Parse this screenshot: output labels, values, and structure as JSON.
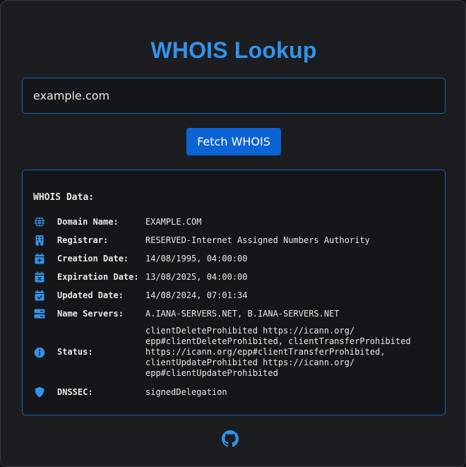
{
  "app": {
    "title": "WHOIS Lookup",
    "accent_color": "#3393ea",
    "button_color": "#0c63d4"
  },
  "search": {
    "value": "example.com",
    "button_label": "Fetch WHOIS"
  },
  "whois": {
    "heading": "WHOIS Data:",
    "rows": [
      {
        "icon": "globe-icon",
        "label": "Domain Name:",
        "value": "EXAMPLE.COM"
      },
      {
        "icon": "building-icon",
        "label": "Registrar:",
        "value": "RESERVED-Internet Assigned Numbers Authority"
      },
      {
        "icon": "calendar-plus-icon",
        "label": "Creation Date:",
        "value": "14/08/1995, 04:00:00"
      },
      {
        "icon": "calendar-x-icon",
        "label": "Expiration Date:",
        "value": "13/08/2025, 04:00:00"
      },
      {
        "icon": "calendar-check-icon",
        "label": "Updated Date:",
        "value": "14/08/2024, 07:01:34"
      },
      {
        "icon": "server-icon",
        "label": "Name Servers:",
        "value": "A.IANA-SERVERS.NET, B.IANA-SERVERS.NET"
      },
      {
        "icon": "info-icon",
        "label": "Status:",
        "value": "clientDeleteProhibited https://icann.org/\nepp#clientDeleteProhibited, clientTransferProhibited\nhttps://icann.org/epp#clientTransferProhibited,\nclientUpdateProhibited https://icann.org/\nepp#clientUpdateProhibited"
      },
      {
        "icon": "shield-icon",
        "label": "DNSSEC:",
        "value": "signedDelegation"
      }
    ]
  },
  "footer": {
    "icon": "github-icon"
  }
}
